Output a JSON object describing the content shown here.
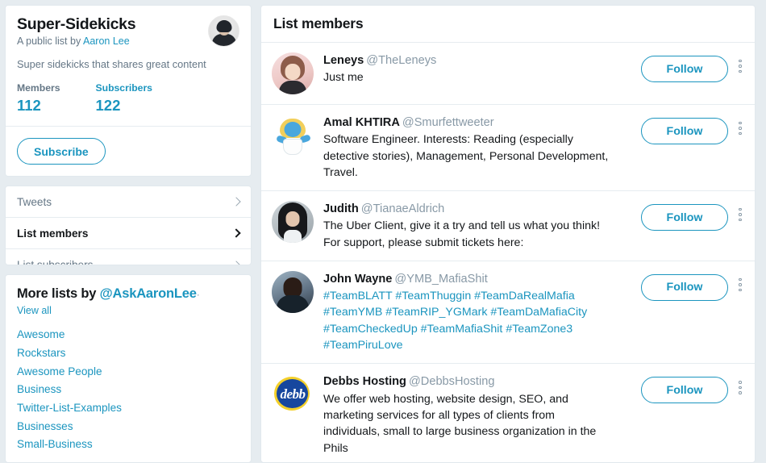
{
  "sidebar": {
    "list": {
      "title": "Super-Sidekicks",
      "byline_prefix": "A public list by ",
      "owner_name": "Aaron Lee",
      "description": "Super sidekicks that shares great content",
      "stats": [
        {
          "label": "Members",
          "value": "112"
        },
        {
          "label": "Subscribers",
          "value": "122"
        }
      ],
      "subscribe_label": "Subscribe"
    },
    "nav": [
      {
        "label": "Tweets",
        "active": false
      },
      {
        "label": "List members",
        "active": true
      },
      {
        "label": "List subscribers",
        "active": false
      }
    ],
    "more_lists": {
      "title_prefix": "More lists by ",
      "handle": "@AskAaronLee",
      "separator": "·",
      "view_all_label": "View all",
      "links": [
        "Awesome",
        "Rockstars",
        "Awesome People",
        "Business",
        "Twitter-List-Examples",
        "Businesses",
        "Small-Business"
      ]
    }
  },
  "main": {
    "title": "List members",
    "follow_label": "Follow",
    "members": [
      {
        "name": "Leneys",
        "handle": "@TheLeneys",
        "bio": "Just me",
        "bio_is_hashtags": false,
        "avatar": "leneys-avatar"
      },
      {
        "name": "Amal KHTIRA",
        "handle": "@Smurfettweeter",
        "bio": "Software Engineer. Interests: Reading (especially detective stories), Management, Personal Development, Travel.",
        "bio_is_hashtags": false,
        "avatar": "smurfette-avatar"
      },
      {
        "name": "Judith",
        "handle": "@TianaeAldrich",
        "bio": "The Uber Client, give it a try and tell us what you think! For support, please submit tickets here:",
        "bio_is_hashtags": false,
        "avatar": "judith-avatar"
      },
      {
        "name": "John Wayne",
        "handle": "@YMB_MafiaShit",
        "bio": "#TeamBLATT #TeamThuggin #TeamDaRealMafia #TeamYMB #TeamRIP_YGMark #TeamDaMafiaCity #TeamCheckedUp #TeamMafiaShit #TeamZone3 #TeamPiruLove",
        "bio_is_hashtags": true,
        "avatar": "john-wayne-avatar"
      },
      {
        "name": "Debbs Hosting",
        "handle": "@DebbsHosting",
        "bio": "We offer web hosting, website design, SEO, and marketing services for all types of clients from individuals, small to large business organization in the Phils",
        "bio_is_hashtags": false,
        "avatar": "debbs-hosting-avatar",
        "avatar_text": "debb"
      }
    ]
  },
  "colors": {
    "accent": "#1b95bf",
    "text": "#14171a",
    "muted": "#8899a6",
    "page_bg": "#e6ecf0"
  }
}
